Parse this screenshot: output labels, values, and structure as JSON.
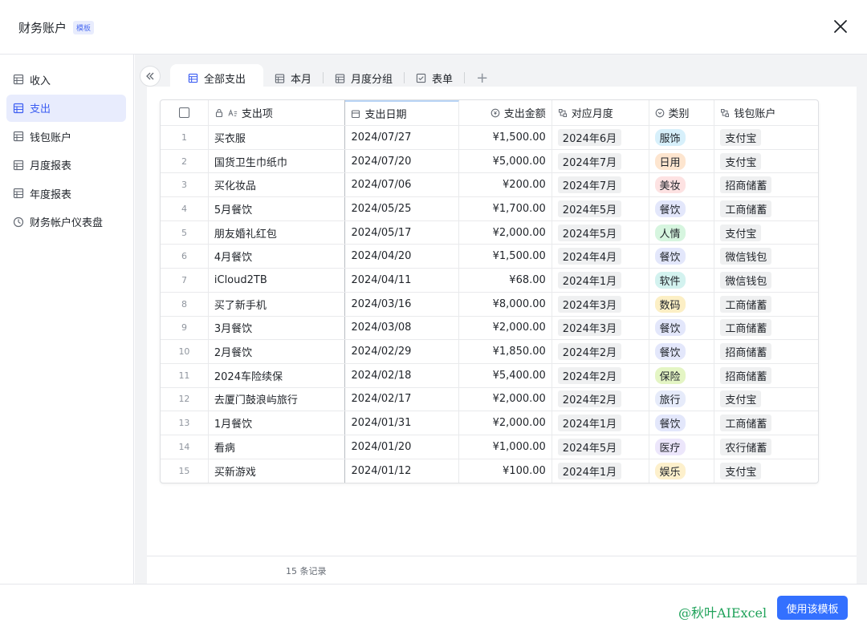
{
  "header": {
    "title": "财务账户",
    "badge": "模板"
  },
  "sidebar": {
    "items": [
      {
        "label": "收入",
        "icon": "table-icon",
        "active": false
      },
      {
        "label": "支出",
        "icon": "table-icon",
        "active": true
      },
      {
        "label": "钱包账户",
        "icon": "table-icon",
        "active": false
      },
      {
        "label": "月度报表",
        "icon": "table-icon",
        "active": false
      },
      {
        "label": "年度报表",
        "icon": "table-icon",
        "active": false
      },
      {
        "label": "财务帐户仪表盘",
        "icon": "dashboard-icon",
        "active": false
      }
    ]
  },
  "tabs": [
    {
      "label": "全部支出",
      "active": true
    },
    {
      "label": "本月",
      "active": false
    },
    {
      "label": "月度分组",
      "active": false
    },
    {
      "label": "表单",
      "active": false
    }
  ],
  "table": {
    "columns": [
      "支出项",
      "支出日期",
      "支出金额",
      "对应月度",
      "类别",
      "钱包账户"
    ],
    "rows": [
      {
        "n": "1",
        "item": "买衣服",
        "date": "2024/07/27",
        "amount": "¥1,500.00",
        "month": "2024年6月",
        "cat": "服饰",
        "wallet": "支付宝"
      },
      {
        "n": "2",
        "item": "国货卫生巾纸巾",
        "date": "2024/07/20",
        "amount": "¥5,000.00",
        "month": "2024年7月",
        "cat": "日用",
        "wallet": "支付宝"
      },
      {
        "n": "3",
        "item": "买化妆品",
        "date": "2024/07/06",
        "amount": "¥200.00",
        "month": "2024年7月",
        "cat": "美妆",
        "wallet": "招商储蓄"
      },
      {
        "n": "4",
        "item": "5月餐饮",
        "date": "2024/05/25",
        "amount": "¥1,700.00",
        "month": "2024年5月",
        "cat": "餐饮",
        "wallet": "工商储蓄"
      },
      {
        "n": "5",
        "item": "朋友婚礼红包",
        "date": "2024/05/17",
        "amount": "¥2,000.00",
        "month": "2024年5月",
        "cat": "人情",
        "wallet": "支付宝"
      },
      {
        "n": "6",
        "item": "4月餐饮",
        "date": "2024/04/20",
        "amount": "¥1,500.00",
        "month": "2024年4月",
        "cat": "餐饮",
        "wallet": "微信钱包"
      },
      {
        "n": "7",
        "item": "iCloud2TB",
        "date": "2024/04/11",
        "amount": "¥68.00",
        "month": "2024年1月",
        "cat": "软件",
        "wallet": "微信钱包"
      },
      {
        "n": "8",
        "item": "买了新手机",
        "date": "2024/03/16",
        "amount": "¥8,000.00",
        "month": "2024年3月",
        "cat": "数码",
        "wallet": "工商储蓄"
      },
      {
        "n": "9",
        "item": "3月餐饮",
        "date": "2024/03/08",
        "amount": "¥2,000.00",
        "month": "2024年3月",
        "cat": "餐饮",
        "wallet": "工商储蓄"
      },
      {
        "n": "10",
        "item": "2月餐饮",
        "date": "2024/02/29",
        "amount": "¥1,850.00",
        "month": "2024年2月",
        "cat": "餐饮",
        "wallet": "招商储蓄"
      },
      {
        "n": "11",
        "item": "2024车险续保",
        "date": "2024/02/18",
        "amount": "¥5,400.00",
        "month": "2024年2月",
        "cat": "保险",
        "wallet": "招商储蓄"
      },
      {
        "n": "12",
        "item": "去厦门鼓浪屿旅行",
        "date": "2024/02/17",
        "amount": "¥2,000.00",
        "month": "2024年2月",
        "cat": "旅行",
        "wallet": "支付宝"
      },
      {
        "n": "13",
        "item": "1月餐饮",
        "date": "2024/01/31",
        "amount": "¥2,000.00",
        "month": "2024年1月",
        "cat": "餐饮",
        "wallet": "工商储蓄"
      },
      {
        "n": "14",
        "item": "看病",
        "date": "2024/01/20",
        "amount": "¥1,000.00",
        "month": "2024年5月",
        "cat": "医疗",
        "wallet": "农行储蓄"
      },
      {
        "n": "15",
        "item": "买新游戏",
        "date": "2024/01/12",
        "amount": "¥100.00",
        "month": "2024年1月",
        "cat": "娱乐",
        "wallet": "支付宝"
      }
    ]
  },
  "category_colors": {
    "服饰": "#d7f0fb",
    "日用": "#fde5cf",
    "美妆": "#fde2e2",
    "餐饮": "#e3e7fb",
    "人情": "#d6f5df",
    "软件": "#d3f2ef",
    "数码": "#fcefc5",
    "保险": "#e4f5c4",
    "旅行": "#e6ebfa",
    "医疗": "#ece6fb",
    "娱乐": "#fdf0cc"
  },
  "footer": {
    "record_count": "15 条记录"
  },
  "bottom": {
    "watermark": "@秋叶AIExcel",
    "use_button": "使用该模板"
  }
}
